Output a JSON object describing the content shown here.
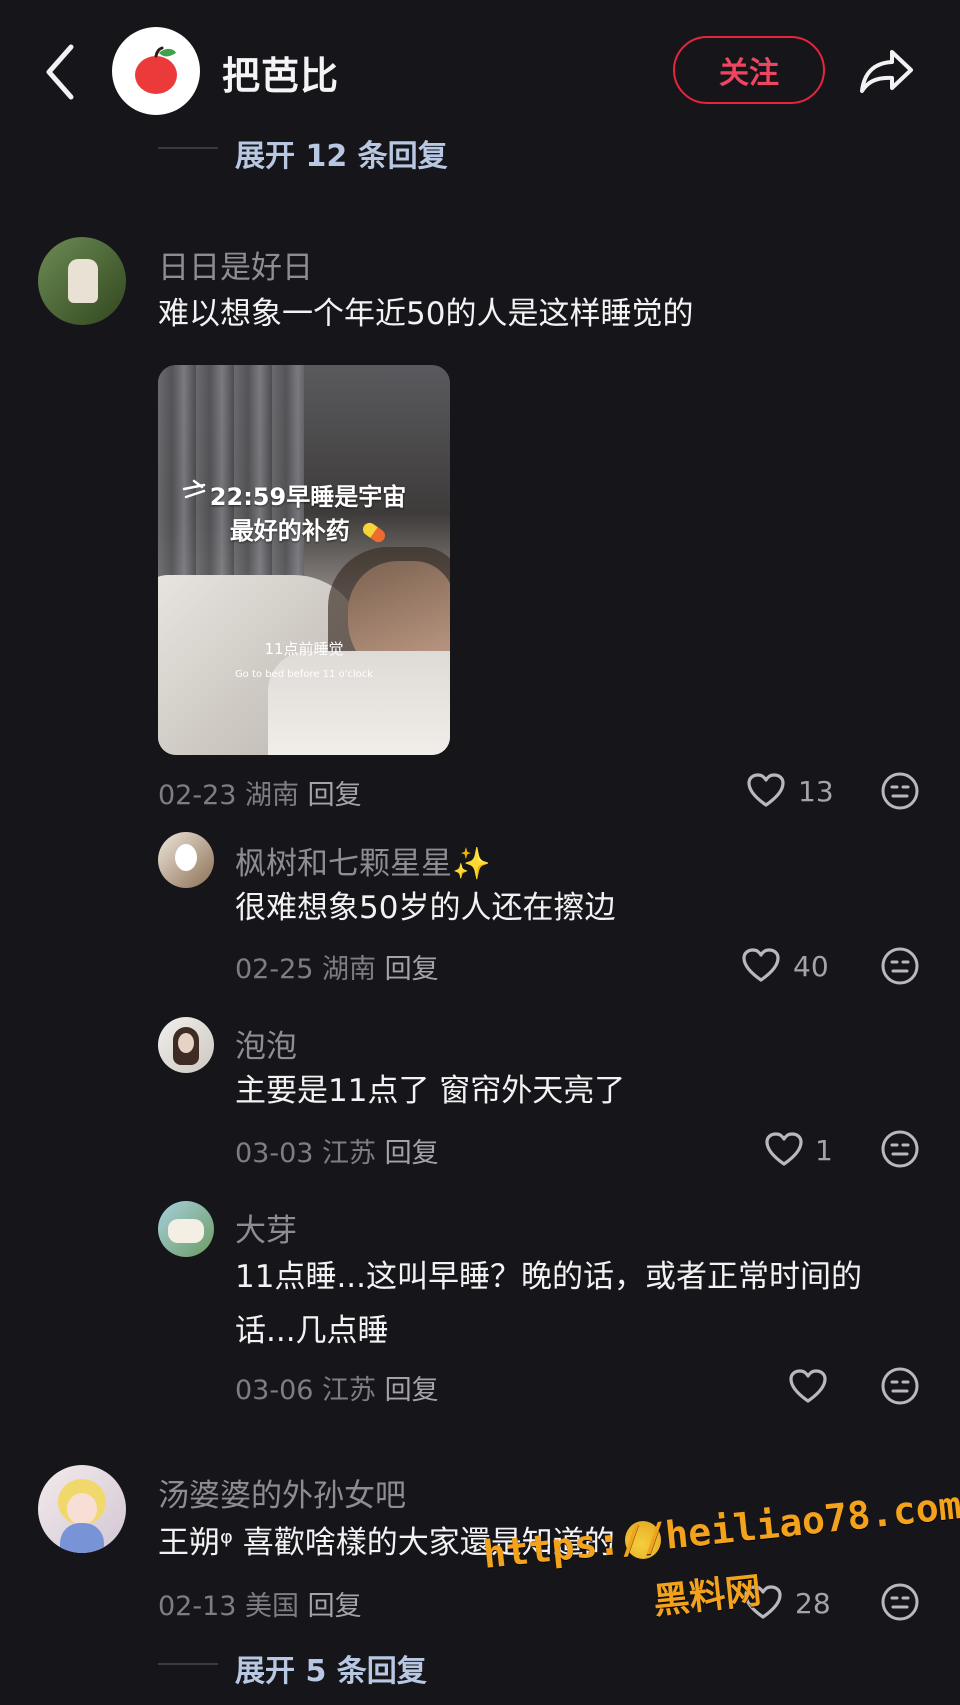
{
  "header": {
    "title": "把芭比",
    "follow_label": "关注"
  },
  "thread_top": {
    "expand_text": "展开 12 条回复"
  },
  "comments": [
    {
      "username": "日日是好日",
      "text": "难以想象一个年近50的人是这样睡觉的",
      "image": {
        "title_line1": "22:59早睡是宇宙",
        "title_line2": "最好的补药",
        "sub_cn": "11点前睡觉",
        "sub_en": "Go to bed before 11 o'clock"
      },
      "date_place": "02-23 湖南",
      "reply": "回复",
      "likes": "13"
    },
    {
      "username": "枫树和七颗星星✨",
      "text": "很难想象50岁的人还在擦边",
      "date_place": "02-25 湖南",
      "reply": "回复",
      "likes": "40"
    },
    {
      "username": "泡泡",
      "text": "主要是11点了 窗帘外天亮了",
      "date_place": "03-03 江苏",
      "reply": "回复",
      "likes": "1"
    },
    {
      "username": "大芽",
      "text_line1": "11点睡...这叫早睡？晚的话，或者正常时间的",
      "text_line2": "话...几点睡",
      "date_place": "03-06 江苏",
      "reply": "回复",
      "likes": ""
    },
    {
      "username": "汤婆婆的外孙女吧",
      "text": "王朔ᵠ 喜歡啥樣的大家還是知道的",
      "date_place": "02-13 美国",
      "reply": "回复",
      "likes": "28"
    }
  ],
  "thread_bottom": {
    "expand_text": "展开 5 条回复"
  },
  "watermark": {
    "url": "https://heiliao78.com",
    "name": "黑料网"
  },
  "colors": {
    "background": "#16161a",
    "accent": "#e7243e",
    "muted": "#8d8d93",
    "link": "#b8c7e2"
  }
}
